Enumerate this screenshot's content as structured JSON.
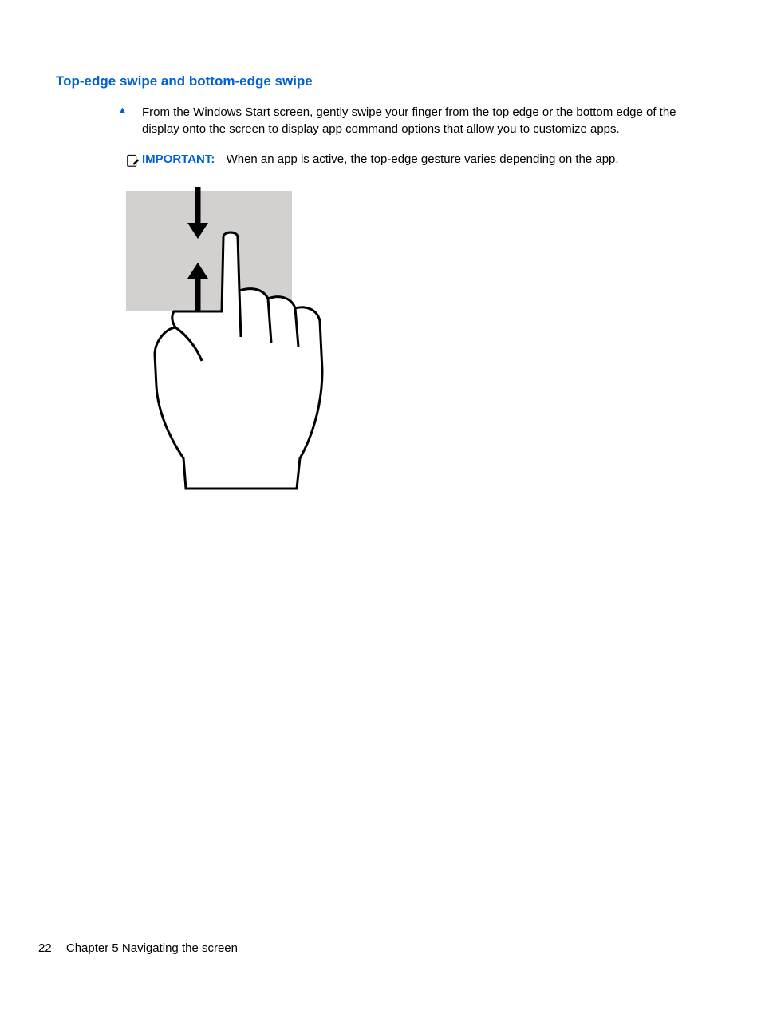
{
  "heading": "Top-edge swipe and bottom-edge swipe",
  "instruction": "From the Windows Start screen, gently swipe your finger from the top edge or the bottom edge of the display onto the screen to display app command options that allow you to customize apps.",
  "note": {
    "label": "IMPORTANT:",
    "text": "When an app is active, the top-edge gesture varies depending on the app."
  },
  "footer": {
    "page_number": "22",
    "chapter": "Chapter 5   Navigating the screen"
  }
}
